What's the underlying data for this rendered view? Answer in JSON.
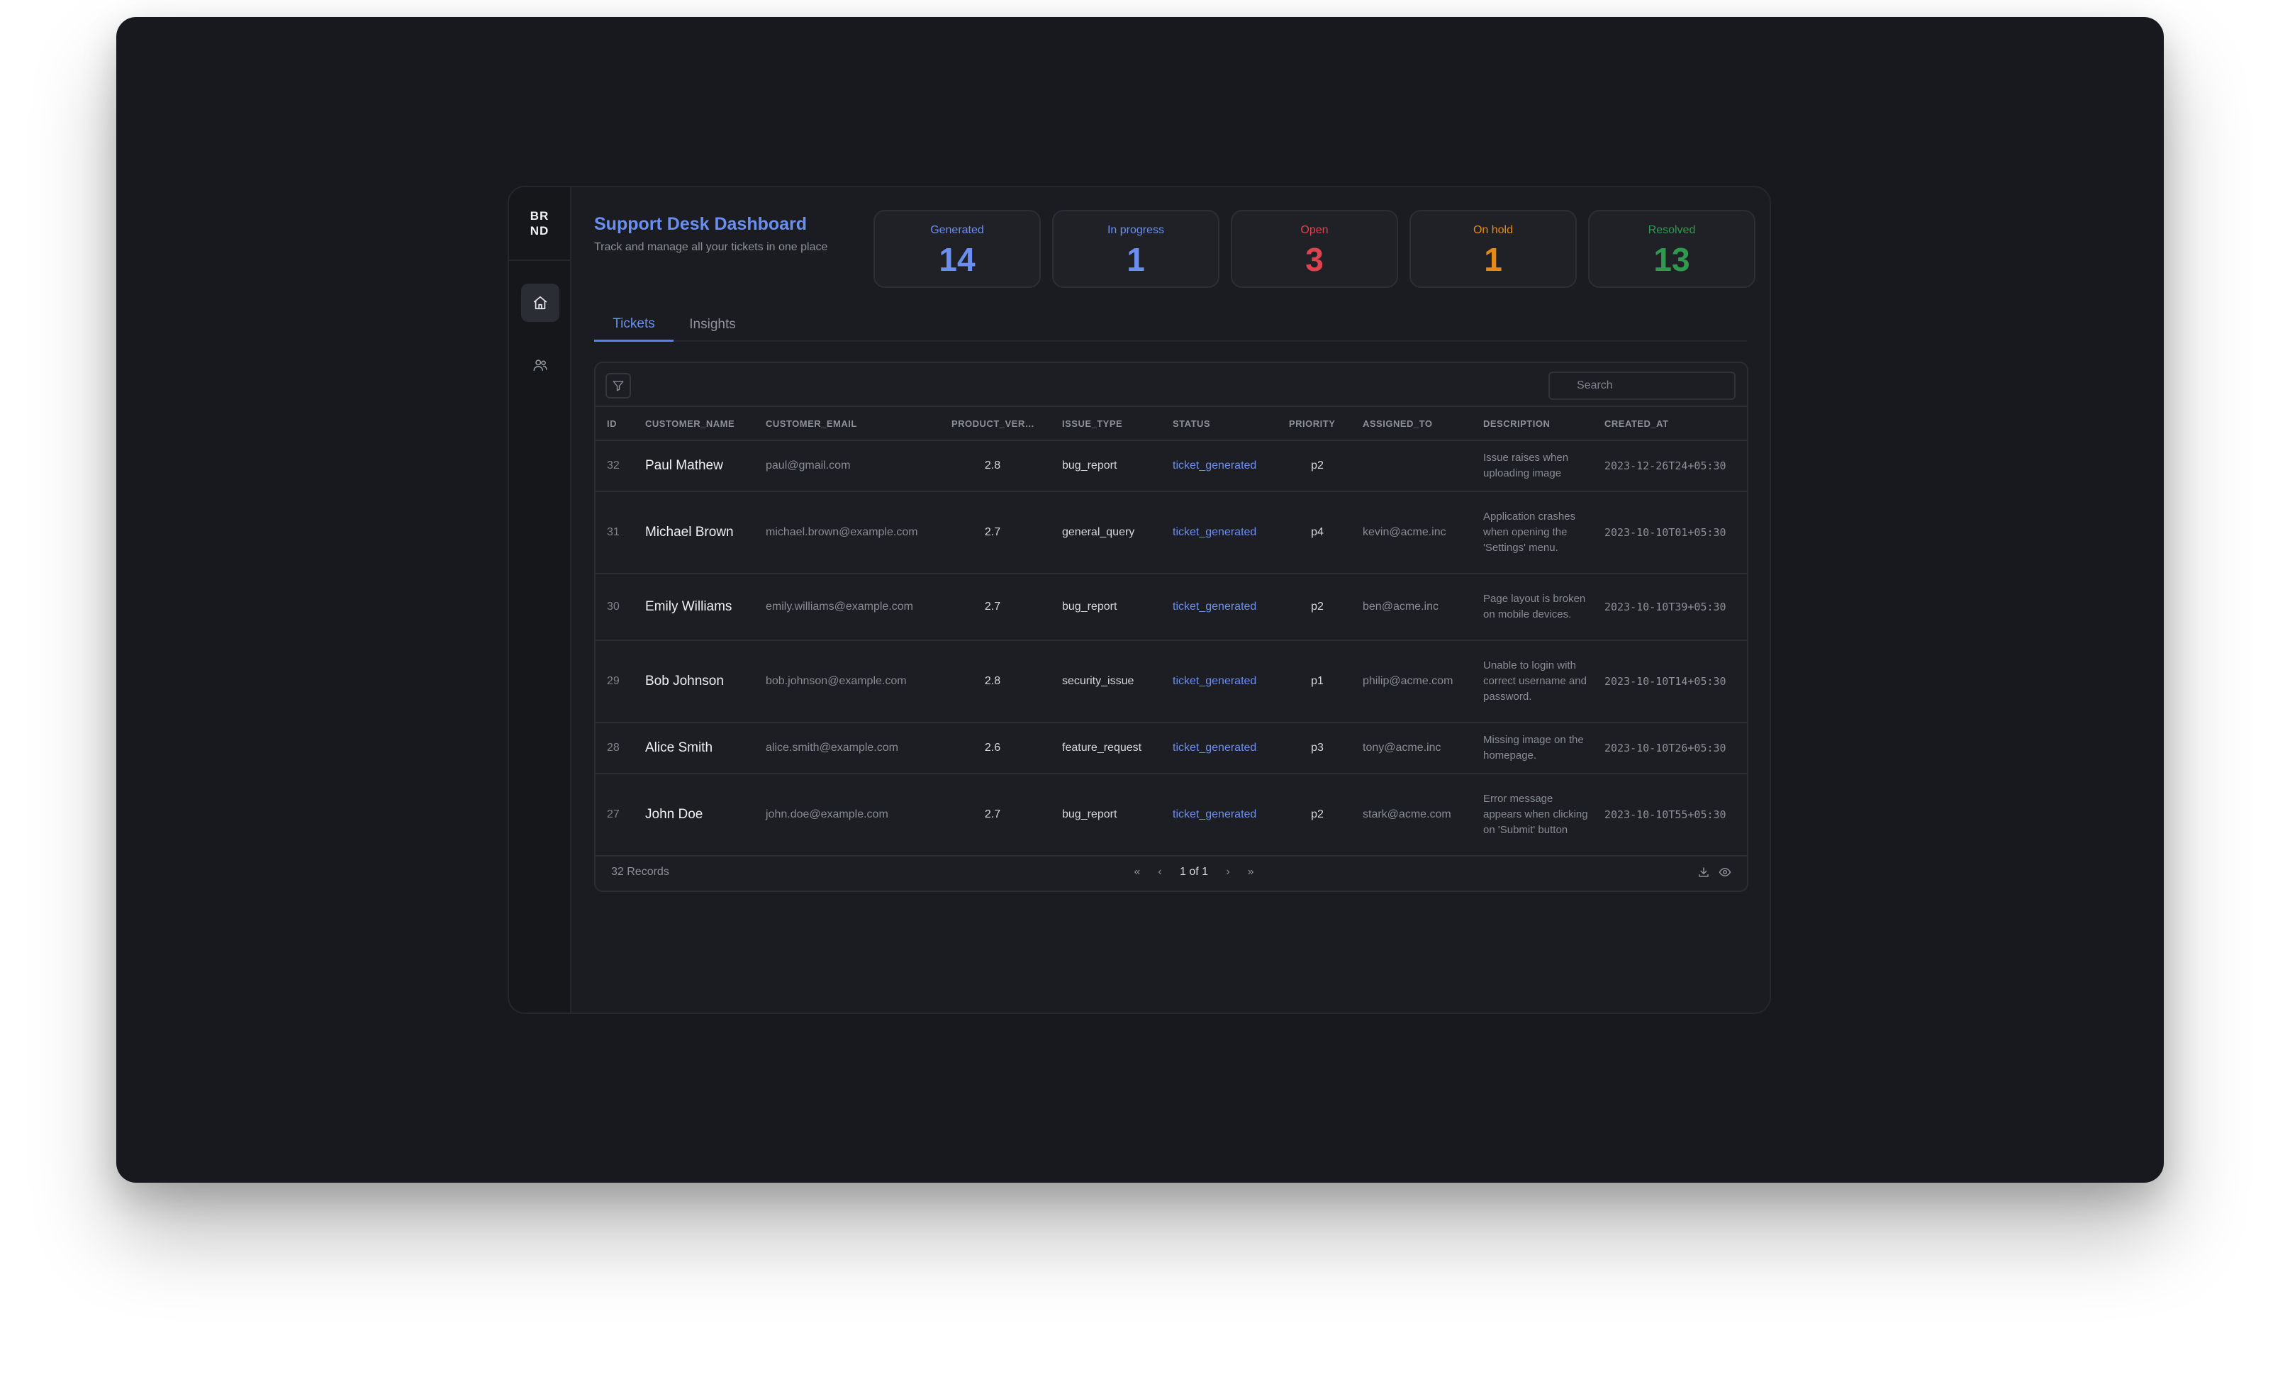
{
  "sidebar": {
    "logo": "BR\nND",
    "items": [
      {
        "icon": "home-icon",
        "active": true
      },
      {
        "icon": "users-icon",
        "active": false
      }
    ]
  },
  "header": {
    "title": "Support Desk Dashboard",
    "subtitle": "Track and manage all your tickets in one place"
  },
  "stats": [
    {
      "label": "Generated",
      "value": "14",
      "color": "#6b8ff0"
    },
    {
      "label": "In progress",
      "value": "1",
      "color": "#6b8ff0"
    },
    {
      "label": "Open",
      "value": "3",
      "color": "#e0434f"
    },
    {
      "label": "On hold",
      "value": "1",
      "color": "#e58a17"
    },
    {
      "label": "Resolved",
      "value": "13",
      "color": "#2f9a4e"
    }
  ],
  "tabs": [
    {
      "label": "Tickets",
      "active": true
    },
    {
      "label": "Insights",
      "active": false
    }
  ],
  "table": {
    "search_placeholder": "Search",
    "columns": [
      "ID",
      "CUSTOMER_NAME",
      "CUSTOMER_EMAIL",
      "PRODUCT_VER…",
      "ISSUE_TYPE",
      "STATUS",
      "PRIORITY",
      "ASSIGNED_TO",
      "DESCRIPTION",
      "CREATED_AT"
    ],
    "rows": [
      {
        "id": "32",
        "name": "Paul Mathew",
        "email": "paul@gmail.com",
        "version": "2.8",
        "issue_type": "bug_report",
        "status": "ticket_generated",
        "priority": "p2",
        "assigned_to": "",
        "description": "Issue raises when uploading image",
        "created_at": "2023-12-26T24+05:30"
      },
      {
        "id": "31",
        "name": "Michael Brown",
        "email": "michael.brown@example.com",
        "version": "2.7",
        "issue_type": "general_query",
        "status": "ticket_generated",
        "priority": "p4",
        "assigned_to": "kevin@acme.inc",
        "description": "Application crashes when opening the 'Settings' menu.",
        "created_at": "2023-10-10T01+05:30"
      },
      {
        "id": "30",
        "name": "Emily Williams",
        "email": "emily.williams@example.com",
        "version": "2.7",
        "issue_type": "bug_report",
        "status": "ticket_generated",
        "priority": "p2",
        "assigned_to": "ben@acme.inc",
        "description": "Page layout is broken on mobile devices.",
        "created_at": "2023-10-10T39+05:30"
      },
      {
        "id": "29",
        "name": "Bob Johnson",
        "email": "bob.johnson@example.com",
        "version": "2.8",
        "issue_type": "security_issue",
        "status": "ticket_generated",
        "priority": "p1",
        "assigned_to": "philip@acme.com",
        "description": "Unable to login with correct username and password.",
        "created_at": "2023-10-10T14+05:30"
      },
      {
        "id": "28",
        "name": "Alice Smith",
        "email": "alice.smith@example.com",
        "version": "2.6",
        "issue_type": "feature_request",
        "status": "ticket_generated",
        "priority": "p3",
        "assigned_to": "tony@acme.inc",
        "description": "Missing image on the homepage.",
        "created_at": "2023-10-10T26+05:30"
      },
      {
        "id": "27",
        "name": "John Doe",
        "email": "john.doe@example.com",
        "version": "2.7",
        "issue_type": "bug_report",
        "status": "ticket_generated",
        "priority": "p2",
        "assigned_to": "stark@acme.com",
        "description": "Error message appears when clicking on 'Submit' button",
        "created_at": "2023-10-10T55+05:30"
      }
    ]
  },
  "footer": {
    "records": "32 Records",
    "page_info": "1 of 1",
    "first": "«",
    "prev": "‹",
    "next": "›",
    "last": "»"
  }
}
